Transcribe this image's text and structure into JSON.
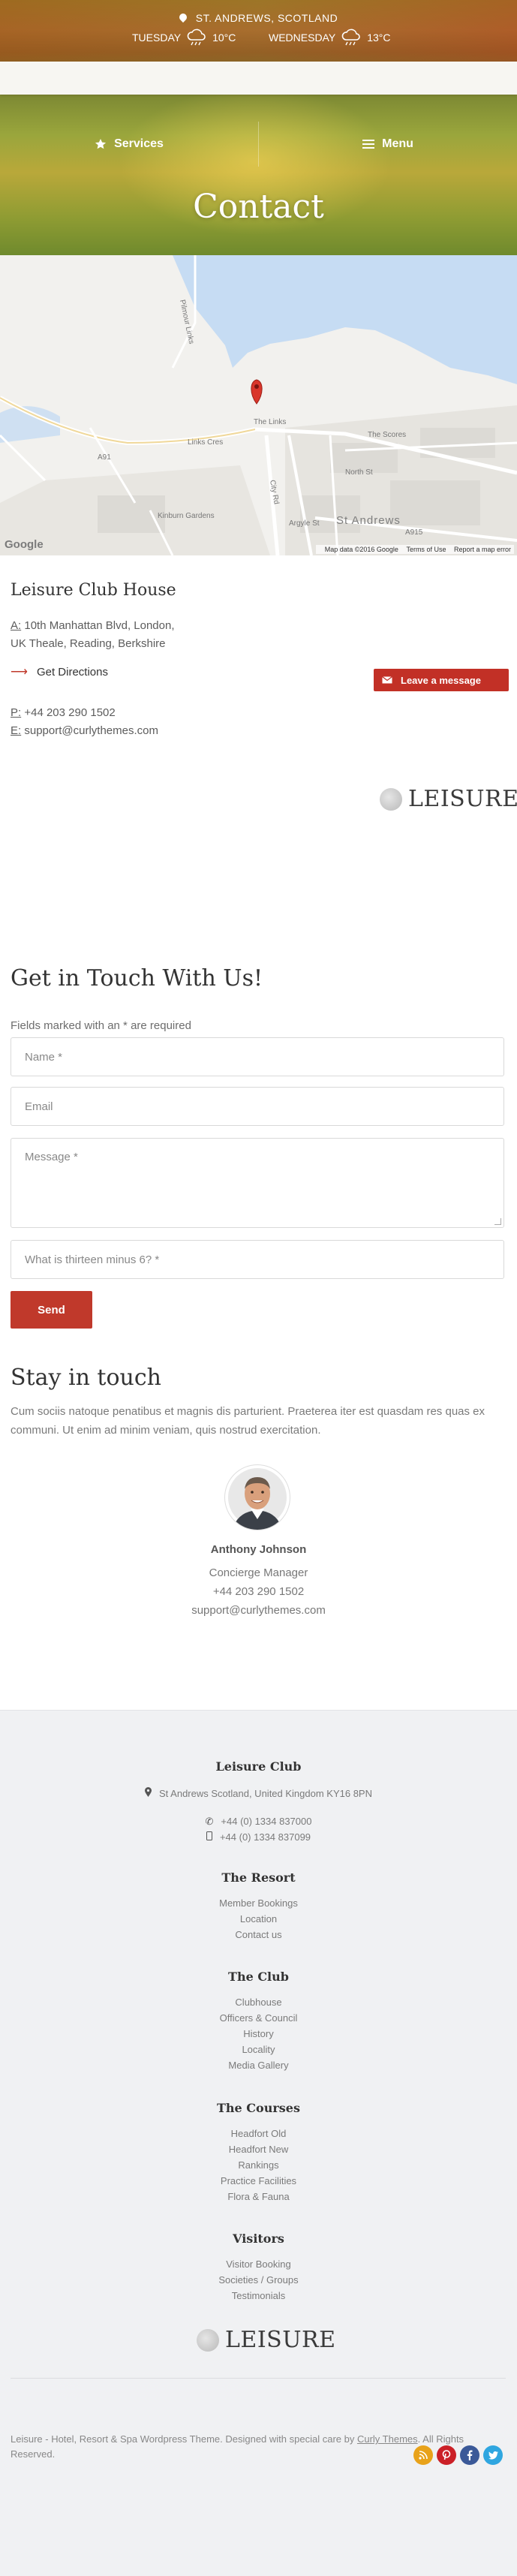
{
  "header": {
    "location": "ST. ANDREWS, SCOTLAND",
    "forecast": [
      {
        "day": "TUESDAY",
        "temp": "10°C",
        "icon": "rain-cloud-icon"
      },
      {
        "day": "WEDNESDAY",
        "temp": "13°C",
        "icon": "rain-cloud-icon"
      }
    ],
    "nav": {
      "services": "Services",
      "menu": "Menu"
    },
    "page_title": "Contact"
  },
  "map": {
    "labels": {
      "links": "The Links",
      "scores": "The Scores",
      "links_cres": "Links Cres",
      "a91": "A91",
      "north_st": "North St",
      "city_rd": "City Rd",
      "st_andrews": "St Andrews",
      "kinburn": "Kinburn Gardens",
      "argyle": "Argyle St",
      "a915": "A915",
      "pilmour": "Pilmour Links"
    },
    "attribution": "Map data ©2016 Google",
    "terms": "Terms of Use",
    "report": "Report a map error",
    "logo": "Google"
  },
  "contact": {
    "title": "Leisure Club House",
    "address_prefix": "A:",
    "address_line1": " 10th Manhattan Blvd, London,",
    "address_line2": "UK Theale, Reading, Berkshire",
    "directions": "Get Directions",
    "phone_prefix": "P:",
    "phone": " +44 203 290 1502",
    "email_prefix": "E:",
    "email": " support@curlythemes.com",
    "leave_message": "Leave a message",
    "logo_text": "LEISURE"
  },
  "form": {
    "title": "Get in Touch With Us!",
    "required_note": "Fields marked with an * are required",
    "name_placeholder": "Name *",
    "email_placeholder": "Email",
    "message_placeholder": "Message *",
    "captcha_placeholder": "What is thirteen minus 6? *",
    "send_label": "Send"
  },
  "stay_in_touch": {
    "title": "Stay in touch",
    "body": "Cum sociis natoque penatibus et magnis dis parturient. Praeterea iter est quasdam res quas ex communi. Ut enim ad minim veniam, quis nostrud exercitation.",
    "person_name": "Anthony Johnson",
    "role": "Concierge Manager",
    "phone": "+44 203 290 1502",
    "email": "support@curlythemes.com"
  },
  "footer": {
    "club_title": "Leisure Club",
    "address": "St Andrews Scotland, United Kingdom KY16 8PN",
    "phone1": "+44 (0) 1334 837000",
    "phone2": "+44 (0) 1334 837099",
    "resort": {
      "title": "The Resort",
      "items": [
        "Member Bookings",
        "Location",
        "Contact us"
      ]
    },
    "club": {
      "title": "The Club",
      "items": [
        "Clubhouse",
        "Officers & Council",
        "History",
        "Locality",
        "Media Gallery"
      ]
    },
    "courses": {
      "title": "The Courses",
      "items": [
        "Headfort Old",
        "Headfort New",
        "Rankings",
        "Practice Facilities",
        "Flora & Fauna"
      ]
    },
    "visitors": {
      "title": "Visitors",
      "items": [
        "Visitor Booking",
        "Societies / Groups",
        "Testimonials"
      ]
    },
    "logo_text": "LEISURE",
    "copyright_prefix": "Leisure - Hotel, Resort & Spa Wordpress Theme. Designed with special care by ",
    "copyright_link": "Curly Themes",
    "copyright_suffix": ". All Rights Reserved.",
    "social": [
      {
        "icon": "rss-icon",
        "color": "#e8a21a"
      },
      {
        "icon": "pinterest-icon",
        "color": "#cb2027"
      },
      {
        "icon": "facebook-icon",
        "color": "#3b5998"
      },
      {
        "icon": "twitter-icon",
        "color": "#2fa6e0"
      }
    ]
  },
  "colors": {
    "accent": "#c0392b",
    "footer_bg": "#f0f1f3",
    "water": "#c6dcf3"
  }
}
